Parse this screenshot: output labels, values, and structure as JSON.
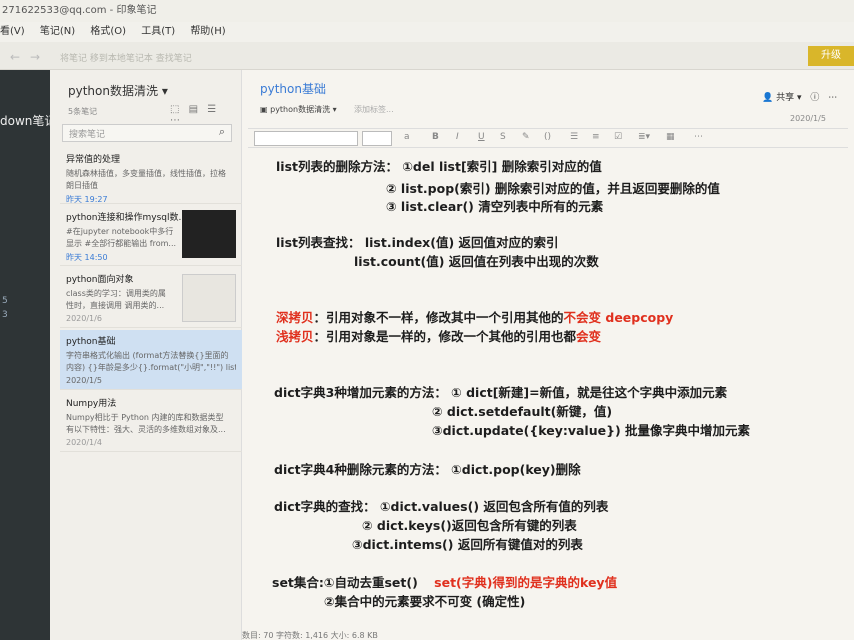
{
  "window": {
    "title": "271622533@qq.com - 印象笔记",
    "menu": [
      "看(V)",
      "笔记(N)",
      "格式(O)",
      "工具(T)",
      "帮助(H)"
    ],
    "toolbar_hint": "将笔记 移到本地笔记本 查找笔记",
    "upgrade_button": "升级"
  },
  "sidebar": {
    "brand": "down笔记",
    "badges": [
      "5",
      "3"
    ]
  },
  "notelist": {
    "notebook_title": "python数据清洗",
    "count": "5条笔记",
    "search_placeholder": "搜索笔记",
    "notes": [
      {
        "title": "异常值的处理",
        "body1": "随机森林插值，多变量插值，线性插值，拉格",
        "body2": "朗日插值",
        "date": "昨天 19:27"
      },
      {
        "title": "python连接和操作mysql数...",
        "body1": "#在jupyter notebook中多行",
        "body2": "显示 #全部行都能输出 from...",
        "date": "昨天 14:50"
      },
      {
        "title": "python面向对象",
        "body1": "class类的学习：调用类的属",
        "body2": "性时，直接调用 调用类的...",
        "date": "2020/1/6"
      },
      {
        "title": "python基础",
        "body1": "字符串格式化输出 (format方法替换{}里面的",
        "body2": "内容) {}年龄是多少{}.format(\"小明\",\"!!\") list...",
        "date": "2020/1/5"
      },
      {
        "title": "Numpy用法",
        "body1": "Numpy相比于 Python 内建的库和数据类型",
        "body2": "有以下特性：强大、灵活的多维数组对象及...",
        "date": "2020/1/4"
      }
    ]
  },
  "editor": {
    "title": "python基础",
    "notebook": "python数据清洗",
    "add_tag": "添加标签...",
    "share": "共享",
    "date": "2020/1/5",
    "lines": [
      "list列表的删除方法：  ①del list[索引]     删除索引对应的值",
      "② list.pop(索引)   删除索引对应的值，并且返回要删除的值",
      "③ list.clear()     清空列表中所有的元素",
      "list列表查找：   list.index(值)  返回值对应的索引",
      "list.count(值)    返回值在列表中出现的次数",
      "深拷贝",
      "：引用对象不一样，修改其中一个引用其他的",
      "不会变  deepcopy",
      "浅拷贝",
      "：引用对象是一样的，修改一个其他的引用也都",
      "会变",
      "dict字典3种增加元素的方法：   ① dict[新建]=新值，就是往这个字典中添加元素",
      "② dict.setdefault(新键，值)",
      "③dict.update({key:value}) 批量像字典中增加元素",
      "dict字典4种删除元素的方法：    ①dict.pop(key)删除",
      "dict字典的查找：    ①dict.values() 返回包含所有值的列表",
      "② dict.keys()返回包含所有键的列表",
      "③dict.intems() 返回所有键值对的列表",
      "set集合:①自动去重set()",
      "set(字典)得到的是字典的key值",
      "②集合中的元素要求不可变 (确定性)"
    ]
  },
  "status": "数目: 70 字符数: 1,416 大小: 6.8 KB"
}
